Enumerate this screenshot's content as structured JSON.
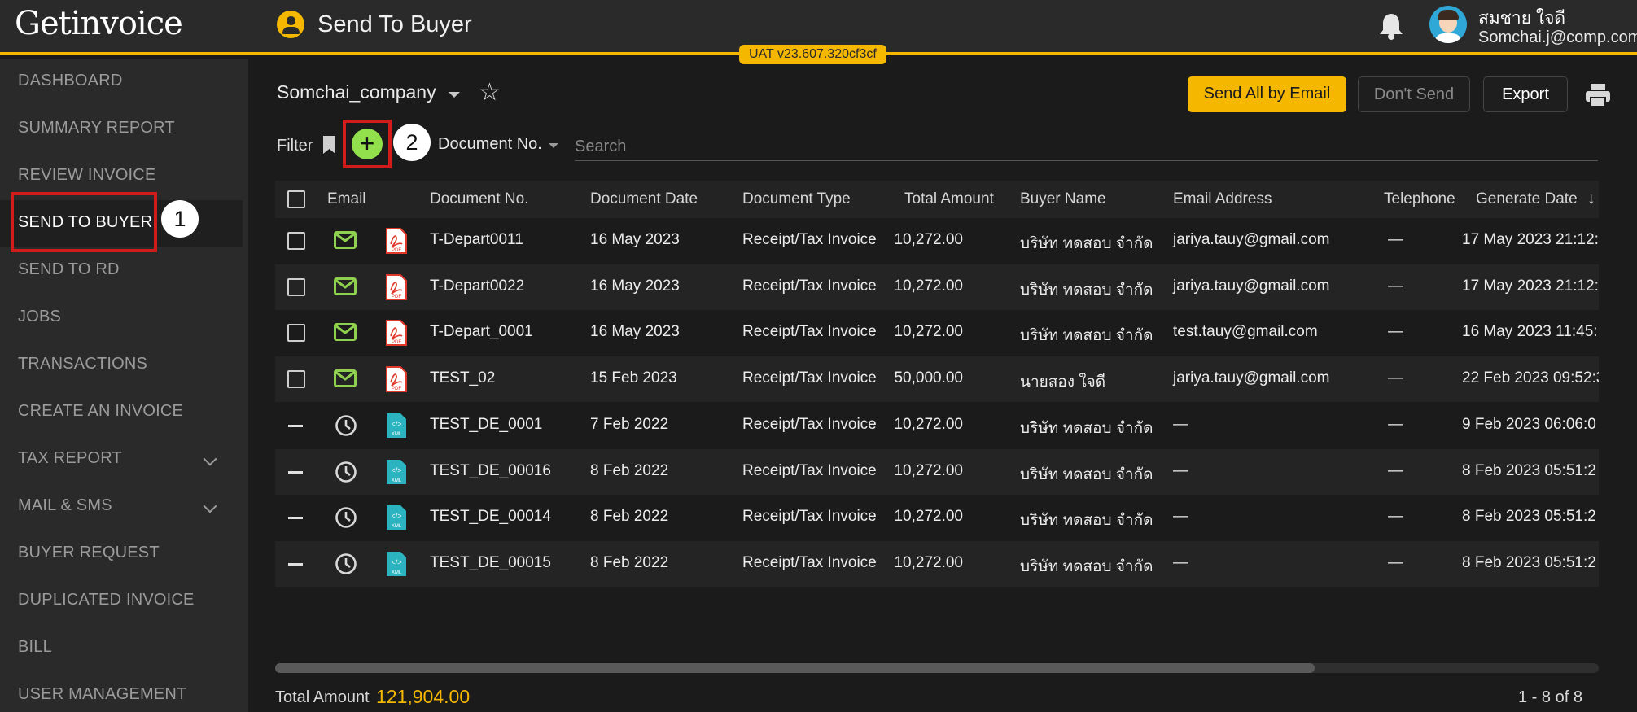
{
  "app": {
    "logo": "Getinvoice",
    "page_title": "Send To Buyer",
    "version": "UAT v23.607.320cf3cf"
  },
  "user": {
    "name": "สมชาย ใจดี",
    "email": "Somchai.j@comp.com"
  },
  "sidebar": {
    "items": [
      {
        "label": "DASHBOARD"
      },
      {
        "label": "SUMMARY REPORT"
      },
      {
        "label": "REVIEW INVOICE"
      },
      {
        "label": "SEND TO BUYER",
        "active": true
      },
      {
        "label": "SEND TO RD"
      },
      {
        "label": "JOBS"
      },
      {
        "label": "TRANSACTIONS"
      },
      {
        "label": "CREATE AN INVOICE"
      },
      {
        "label": "TAX REPORT",
        "expandable": true
      },
      {
        "label": "MAIL & SMS",
        "expandable": true
      },
      {
        "label": "BUYER REQUEST"
      },
      {
        "label": "DUPLICATED INVOICE"
      },
      {
        "label": "BILL"
      },
      {
        "label": "USER MANAGEMENT"
      }
    ]
  },
  "callouts": {
    "one": "1",
    "two": "2"
  },
  "toolbar": {
    "company": "Somchai_company",
    "send_all_label": "Send All by Email",
    "dont_send_label": "Don't Send",
    "export_label": "Export"
  },
  "filter": {
    "label": "Filter",
    "add_symbol": "+",
    "field": "Document No.",
    "search_placeholder": "Search"
  },
  "table": {
    "columns": [
      "Email",
      "Document No.",
      "Document Date",
      "Document Type",
      "Total Amount",
      "Buyer Name",
      "Email Address",
      "Telephone",
      "Generate Date"
    ],
    "sort_indicator": "↓",
    "rows": [
      {
        "status": "mail",
        "file": "PDF",
        "doc_no": "T-Depart0011",
        "doc_date": "16 May 2023",
        "doc_type": "Receipt/Tax Invoice",
        "amount": "10,272.00",
        "buyer": "บริษัท ทดสอบ จำกัด",
        "email": "jariya.tauy@gmail.com",
        "phone": "—",
        "gen_date": "17 May 2023 21:12:"
      },
      {
        "status": "mail",
        "file": "PDF",
        "doc_no": "T-Depart0022",
        "doc_date": "16 May 2023",
        "doc_type": "Receipt/Tax Invoice",
        "amount": "10,272.00",
        "buyer": "บริษัท ทดสอบ จำกัด",
        "email": "jariya.tauy@gmail.com",
        "phone": "—",
        "gen_date": "17 May 2023 21:12:"
      },
      {
        "status": "mail",
        "file": "PDF",
        "doc_no": "T-Depart_0001",
        "doc_date": "16 May 2023",
        "doc_type": "Receipt/Tax Invoice",
        "amount": "10,272.00",
        "buyer": "บริษัท ทดสอบ จำกัด",
        "email": "test.tauy@gmail.com",
        "phone": "—",
        "gen_date": "16 May 2023 11:45:"
      },
      {
        "status": "mail",
        "file": "PDF",
        "doc_no": "TEST_02",
        "doc_date": "15 Feb 2023",
        "doc_type": "Receipt/Tax Invoice",
        "amount": "50,000.00",
        "buyer": "นายสอง ใจดี",
        "email": "jariya.tauy@gmail.com",
        "phone": "—",
        "gen_date": "22 Feb 2023 09:52:3"
      },
      {
        "status": "clock",
        "file": "XML",
        "doc_no": "TEST_DE_0001",
        "doc_date": "7 Feb 2022",
        "doc_type": "Receipt/Tax Invoice",
        "amount": "10,272.00",
        "buyer": "บริษัท ทดสอบ จำกัด",
        "email": "—",
        "phone": "—",
        "gen_date": "9 Feb 2023 06:06:0"
      },
      {
        "status": "clock",
        "file": "XML",
        "doc_no": "TEST_DE_00016",
        "doc_date": "8 Feb 2022",
        "doc_type": "Receipt/Tax Invoice",
        "amount": "10,272.00",
        "buyer": "บริษัท ทดสอบ จำกัด",
        "email": "—",
        "phone": "—",
        "gen_date": "8 Feb 2023 05:51:2"
      },
      {
        "status": "clock",
        "file": "XML",
        "doc_no": "TEST_DE_00014",
        "doc_date": "8 Feb 2022",
        "doc_type": "Receipt/Tax Invoice",
        "amount": "10,272.00",
        "buyer": "บริษัท ทดสอบ จำกัด",
        "email": "—",
        "phone": "—",
        "gen_date": "8 Feb 2023 05:51:2"
      },
      {
        "status": "clock",
        "file": "XML",
        "doc_no": "TEST_DE_00015",
        "doc_date": "8 Feb 2022",
        "doc_type": "Receipt/Tax Invoice",
        "amount": "10,272.00",
        "buyer": "บริษัท ทดสอบ จำกัด",
        "email": "—",
        "phone": "—",
        "gen_date": "8 Feb 2023 05:51:2"
      }
    ]
  },
  "footer": {
    "total_label": "Total Amount",
    "total_value": "121,904.00",
    "pagination": "1 - 8 of 8"
  },
  "colors": {
    "accent": "#f5b700",
    "mail_green": "#8fd14f",
    "add_green": "#92e04b",
    "pdf_red": "#e0382b",
    "xml_teal": "#2bb3c0",
    "callout_red": "#d21c1c"
  }
}
